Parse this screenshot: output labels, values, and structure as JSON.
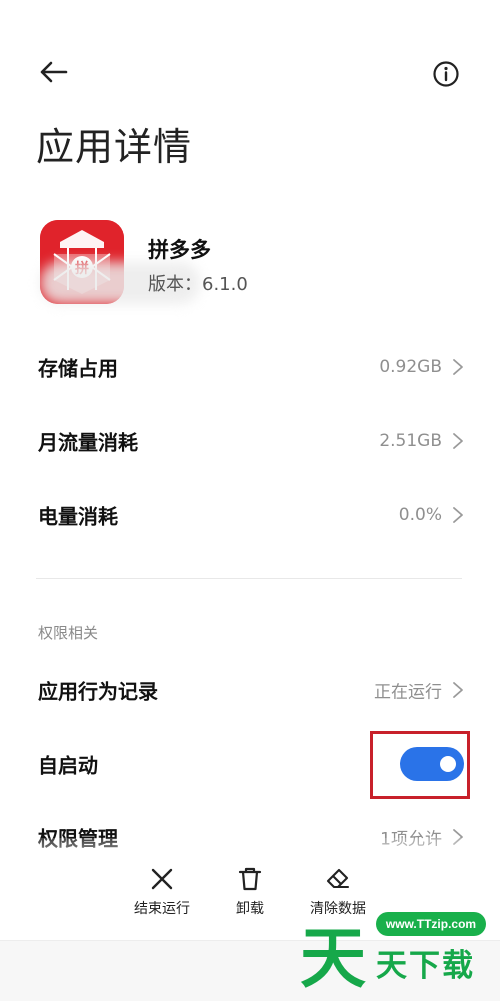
{
  "header": {
    "back_icon": "arrow-left-icon",
    "info_icon": "info-circle-icon",
    "title": "应用详情"
  },
  "app": {
    "name": "拼多多",
    "version": "版本：6.1.0",
    "icon": "pinduoduo-app-icon",
    "icon_glyph": "拼",
    "brand_color": "#e0232b"
  },
  "usage": [
    {
      "label": "存储占用",
      "value": "0.92GB"
    },
    {
      "label": "月流量消耗",
      "value": "2.51GB"
    },
    {
      "label": "电量消耗",
      "value": "0.0%"
    }
  ],
  "permissions": {
    "section_title": "权限相关",
    "rows": [
      {
        "label": "应用行为记录",
        "value": "正在运行"
      },
      {
        "label": "自启动",
        "toggle_on": true
      },
      {
        "label": "权限管理",
        "value": "1项允许"
      }
    ]
  },
  "actions": [
    {
      "label": "结束运行",
      "icon": "close-icon"
    },
    {
      "label": "卸载",
      "icon": "trash-icon"
    },
    {
      "label": "清除数据",
      "icon": "eraser-icon"
    }
  ],
  "watermark": {
    "url": "www.TTzip.com",
    "big_char": "天",
    "text": "天下载",
    "color": "#16a84a"
  },
  "colors": {
    "toggle_on": "#2a73e8",
    "highlight_border": "#c8202a",
    "secondary_text": "#8f8f8f"
  }
}
